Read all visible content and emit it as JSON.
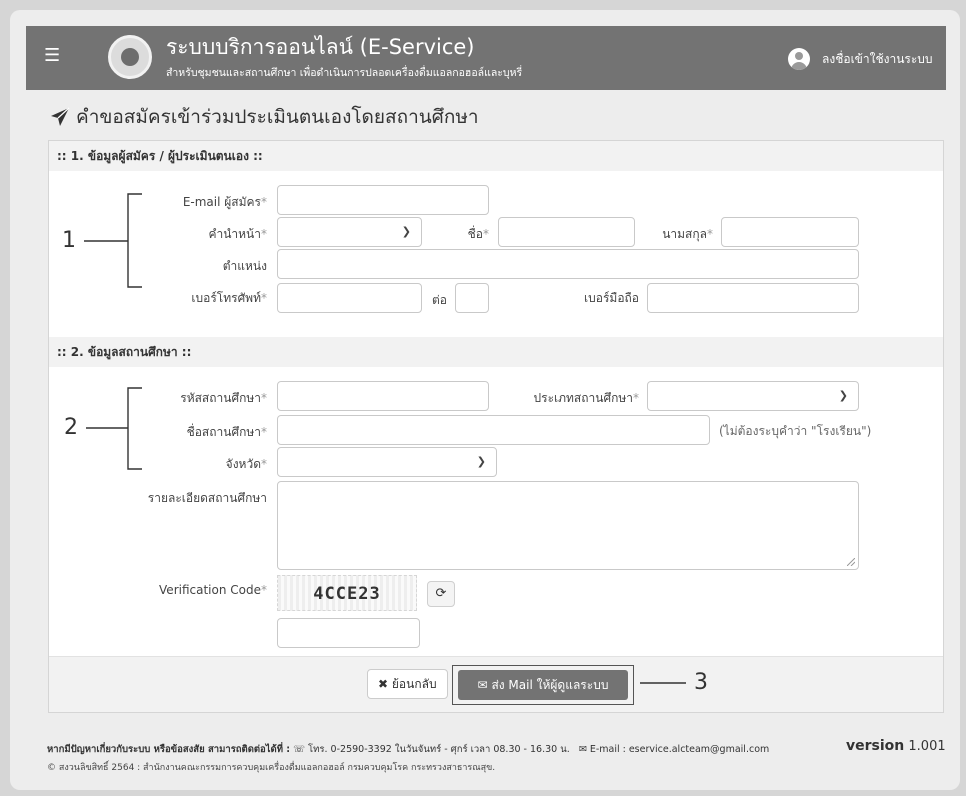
{
  "header": {
    "menu_icon": "hamburger-icon",
    "logo_icon": "department-emblem-icon",
    "title": "ระบบบริการออนไลน์ (E-Service)",
    "subtitle": "สำหรับชุมชนและสถานศึกษา เพื่อดำเนินการปลอดเครื่องดื่มแอลกอฮอล์และบุหรี่",
    "login_label": "ลงชื่อเข้าใช้งานระบบ"
  },
  "page": {
    "title": "คำขอสมัครเข้าร่วมประเมินตนเองโดยสถานศึกษา"
  },
  "section1": {
    "heading": ":: 1. ข้อมูลผู้สมัคร / ผู้ประเมินตนเอง ::",
    "email_label": "E-mail ผู้สมัคร",
    "prefix_label": "คำนำหน้า",
    "firstname_label": "ชื่อ",
    "lastname_label": "นามสกุล",
    "position_label": "ตำแหน่ง",
    "phone_label": "เบอร์โทรศัพท์",
    "ext_label": "ต่อ",
    "mobile_label": "เบอร์มือถือ"
  },
  "section2": {
    "heading": ":: 2. ข้อมูลสถานศึกษา ::",
    "school_code_label": "รหัสสถานศึกษา",
    "school_type_label": "ประเภทสถานศึกษา",
    "school_name_label": "ชื่อสถานศึกษา",
    "school_name_hint": "(ไม่ต้องระบุคำว่า \"โรงเรียน\")",
    "province_label": "จังหวัด",
    "details_label": "รายละเอียดสถานศึกษา",
    "verification_label": "Verification Code",
    "captcha_text": "4CCE23"
  },
  "required_mark": "*",
  "buttons": {
    "back_label": "ย้อนกลับ",
    "send_label": "ส่ง Mail ให้ผู้ดูแลระบบ"
  },
  "annotations": {
    "one": "1",
    "two": "2",
    "three": "3"
  },
  "footer": {
    "contact_prefix": "หากมีปัญหาเกี่ยวกับระบบ หรือข้อสงสัย สามารถติดต่อได้ที่ :",
    "phone": "โทร. 0-2590-3392 ในวันจันทร์ - ศุกร์ เวลา 08.30 - 16.30 น.",
    "email": "E-mail : eservice.alcteam@gmail.com",
    "version_word": "version",
    "version_number": "1.001",
    "copyright": "© สงวนลิขสิทธิ์ 2564 : สำนักงานคณะกรรมการควบคุมเครื่องดื่มแอลกอฮอล์ กรมควบคุมโรค กระทรวงสาธารณสุข."
  },
  "colors": {
    "header_bg": "#737373",
    "section_bg": "#f2f2f2",
    "primary_button": "#737373"
  }
}
